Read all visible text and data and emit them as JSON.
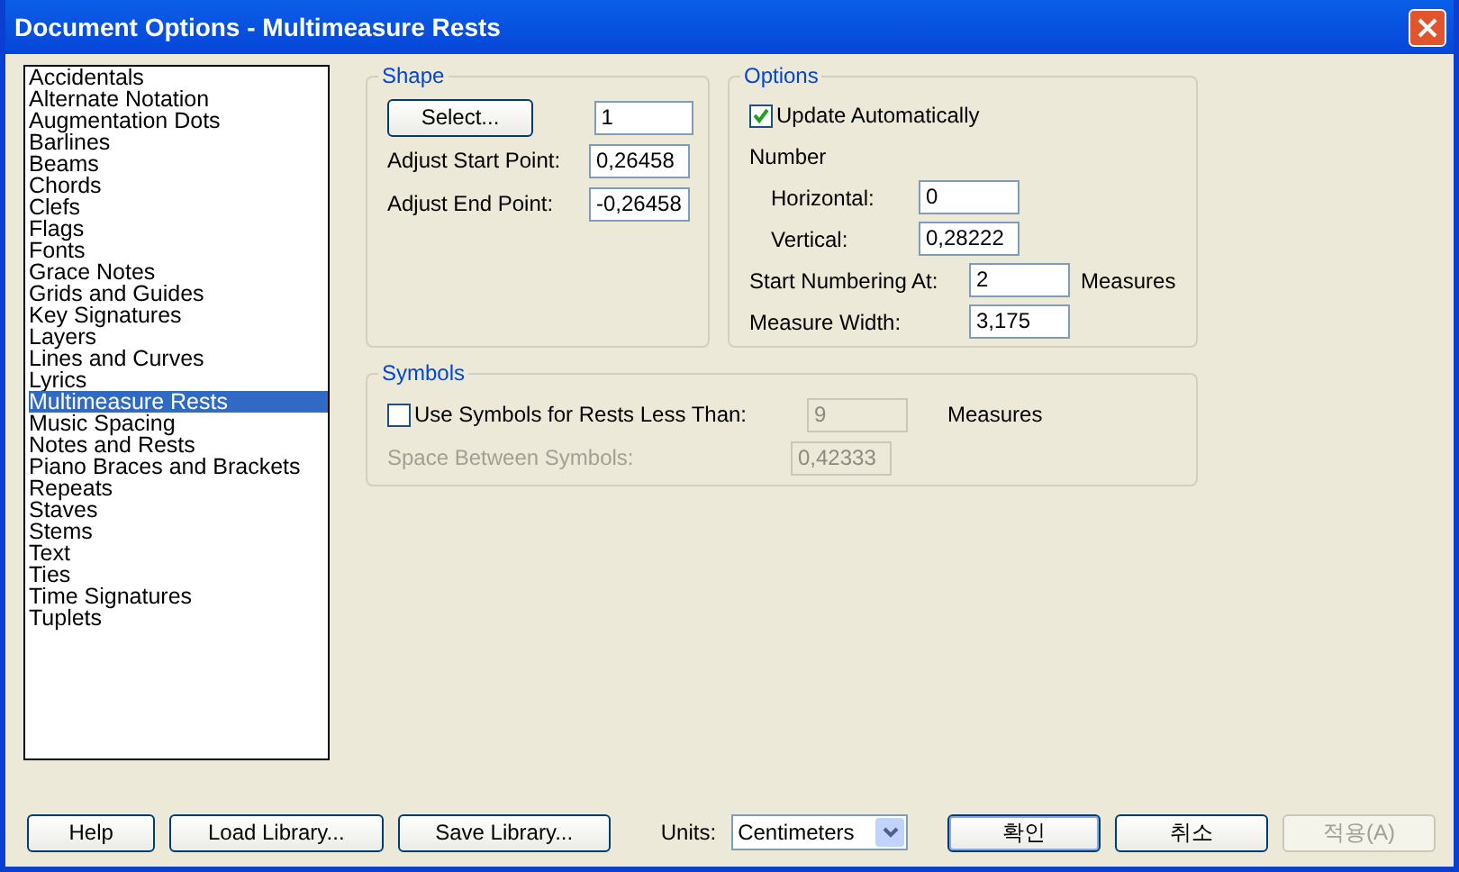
{
  "window": {
    "title": "Document Options - Multimeasure Rests"
  },
  "categories": [
    {
      "label": "Accidentals",
      "selected": false
    },
    {
      "label": "Alternate Notation",
      "selected": false
    },
    {
      "label": "Augmentation Dots",
      "selected": false
    },
    {
      "label": "Barlines",
      "selected": false
    },
    {
      "label": "Beams",
      "selected": false
    },
    {
      "label": "Chords",
      "selected": false
    },
    {
      "label": "Clefs",
      "selected": false
    },
    {
      "label": "Flags",
      "selected": false
    },
    {
      "label": "Fonts",
      "selected": false
    },
    {
      "label": "Grace Notes",
      "selected": false
    },
    {
      "label": "Grids and Guides",
      "selected": false
    },
    {
      "label": "Key Signatures",
      "selected": false
    },
    {
      "label": "Layers",
      "selected": false
    },
    {
      "label": "Lines and Curves",
      "selected": false
    },
    {
      "label": "Lyrics",
      "selected": false
    },
    {
      "label": "Multimeasure Rests",
      "selected": true
    },
    {
      "label": "Music Spacing",
      "selected": false
    },
    {
      "label": "Notes and Rests",
      "selected": false
    },
    {
      "label": "Piano Braces and Brackets",
      "selected": false
    },
    {
      "label": "Repeats",
      "selected": false
    },
    {
      "label": "Staves",
      "selected": false
    },
    {
      "label": "Stems",
      "selected": false
    },
    {
      "label": "Text",
      "selected": false
    },
    {
      "label": "Ties",
      "selected": false
    },
    {
      "label": "Time Signatures",
      "selected": false
    },
    {
      "label": "Tuplets",
      "selected": false
    }
  ],
  "shape": {
    "title": "Shape",
    "select_button": "Select...",
    "shape_value": "1",
    "fields": [
      {
        "label": "Adjust Start Point:",
        "value": "0,26458"
      },
      {
        "label": "Adjust End Point:",
        "value": "-0,26458"
      }
    ]
  },
  "options": {
    "title": "Options",
    "update_automatically": {
      "label": "Update Automatically",
      "checked": true
    },
    "number_label": "Number",
    "horizontal": {
      "label": "Horizontal:",
      "value": "0"
    },
    "vertical": {
      "label": "Vertical:",
      "value": "0,28222"
    },
    "start_numbering": {
      "label": "Start Numbering At:",
      "value": "2",
      "unit": "Measures"
    },
    "measure_width": {
      "label": "Measure Width:",
      "value": "3,175"
    }
  },
  "symbols": {
    "title": "Symbols",
    "use_symbols": {
      "label": "Use Symbols for Rests Less Than:",
      "checked": false,
      "value": "9",
      "unit": "Measures",
      "disabled": true
    },
    "space_between": {
      "label": "Space Between Symbols:",
      "value": "0,42333",
      "disabled": true
    }
  },
  "footer": {
    "buttons": [
      {
        "label": "Help",
        "disabled": false
      },
      {
        "label": "Load Library...",
        "disabled": false
      },
      {
        "label": "Save Library...",
        "disabled": false
      }
    ],
    "units_label": "Units:",
    "units_value": "Centimeters",
    "actions": [
      {
        "label": "확인",
        "disabled": false,
        "default": true
      },
      {
        "label": "취소",
        "disabled": false,
        "default": false
      },
      {
        "label": "적용(A)",
        "disabled": true,
        "default": false
      }
    ]
  }
}
